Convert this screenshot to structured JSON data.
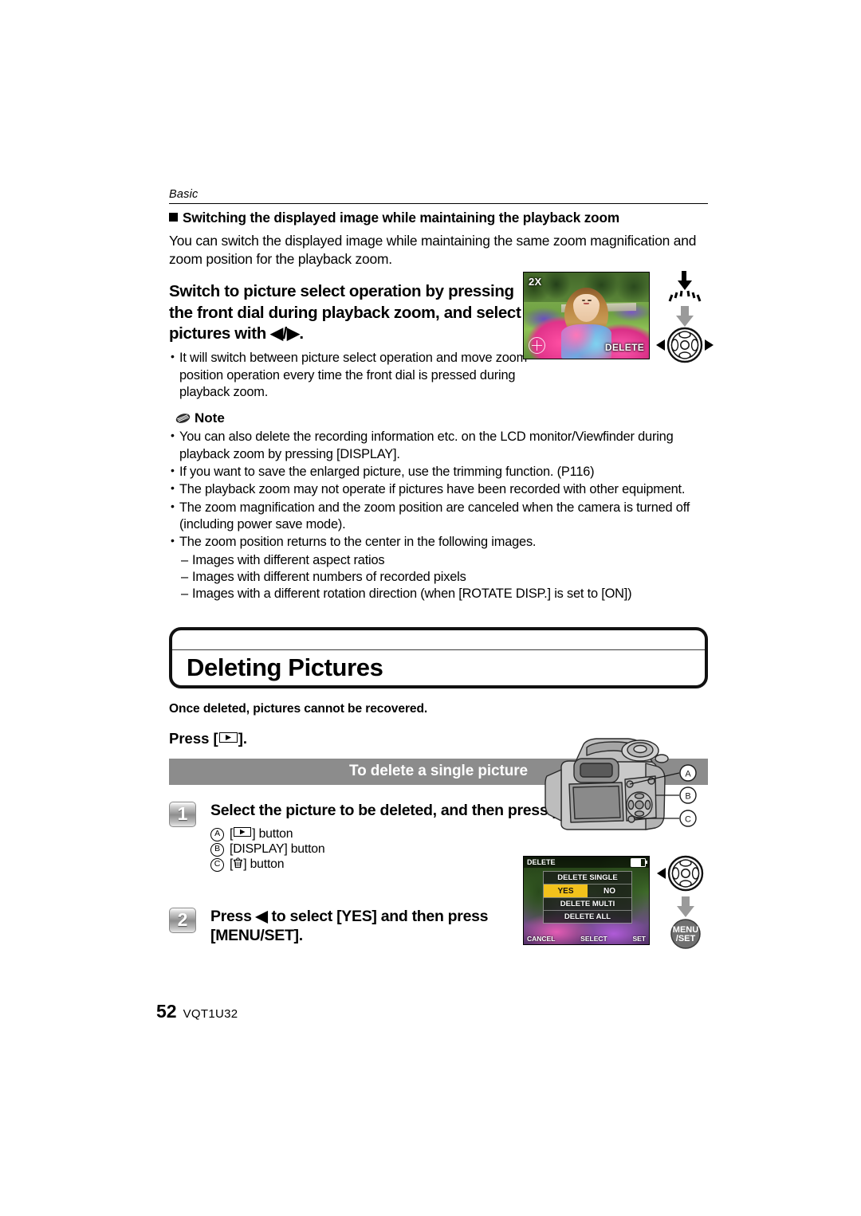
{
  "running_head": "Basic",
  "section": {
    "heading": "Switching the displayed image while maintaining the playback zoom",
    "intro": "You can switch the displayed image while maintaining the same zoom magnification and zoom position for the playback zoom.",
    "instruction": "Switch to picture select operation by pressing the front dial during playback zoom, and select pictures with ◀/▶.",
    "bullet": "It will switch between picture select operation and move zoom position operation every time the front dial is pressed during playback zoom."
  },
  "note": {
    "label": "Note",
    "items": [
      "You can also delete the recording information etc. on the LCD monitor/Viewfinder during playback zoom by pressing [DISPLAY].",
      "If you want to save the enlarged picture, use the trimming function. (P116)",
      "The playback zoom may not operate if pictures have been recorded with other equipment.",
      "The zoom magnification and the zoom position are canceled when the camera is turned off (including power save mode).",
      "The zoom position returns to the center in the following images."
    ],
    "sub_items": [
      "Images with different aspect ratios",
      "Images with different numbers of recorded pixels",
      "Images with a different rotation direction (when [ROTATE DISP.] is set to [ON])"
    ]
  },
  "chapter": {
    "title": "Deleting Pictures",
    "warning": "Once deleted, pictures cannot be recovered.",
    "press_prefix": "Press [",
    "press_suffix": "].",
    "band": "To delete a single picture"
  },
  "steps": [
    {
      "number": "1",
      "text_a": "Select the picture to be deleted, and then press [",
      "text_b": "].",
      "callouts": [
        {
          "marker": "A",
          "label_pre": "[",
          "label_post": "] button",
          "key": "playback"
        },
        {
          "marker": "B",
          "label": "[DISPLAY] button"
        },
        {
          "marker": "C",
          "label_pre": "[",
          "label_post": "] button",
          "key": "trash"
        }
      ]
    },
    {
      "number": "2",
      "text": "Press ◀ to select [YES] and then press [MENU/SET]."
    }
  ],
  "figures": {
    "playback_photo": {
      "zoom_label": "2X",
      "delete_label": "DELETE"
    },
    "delete_menu": {
      "title": "DELETE",
      "rows": [
        "DELETE SINGLE",
        "DELETE MULTI",
        "DELETE ALL"
      ],
      "yes": "YES",
      "no": "NO",
      "bottom_left": "CANCEL",
      "bottom_mid": "SELECT",
      "bottom_right": "SET"
    },
    "camera_callouts": [
      "A",
      "B",
      "C"
    ],
    "menu_set_label_line1": "MENU",
    "menu_set_label_line2": "/SET"
  },
  "footer": {
    "page_number": "52",
    "doc_code": "VQT1U32"
  },
  "colors": {
    "band_gray": "#8c8c8c",
    "highlight_yellow": "#f2c21c",
    "ink": "#000000"
  }
}
